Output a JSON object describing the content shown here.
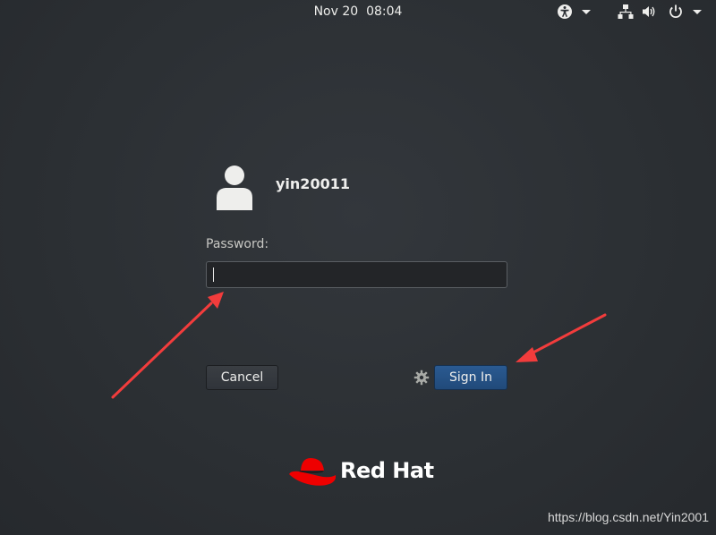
{
  "topbar": {
    "clock": "Nov 20  08:04",
    "icons": [
      "accessibility-icon",
      "network-icon",
      "volume-icon",
      "power-icon"
    ]
  },
  "login": {
    "username": "yin20011",
    "password_label": "Password:",
    "password_value": "",
    "cancel_label": "Cancel",
    "signin_label": "Sign In",
    "settings_icon": "gear-icon"
  },
  "branding": {
    "logo_text": "Red Hat",
    "logo_color": "#ee0000"
  },
  "watermark": "https://blog.csdn.net/Yin2001",
  "colors": {
    "accent": "#2a5a91",
    "annotation_arrow": "#f23c3c"
  }
}
